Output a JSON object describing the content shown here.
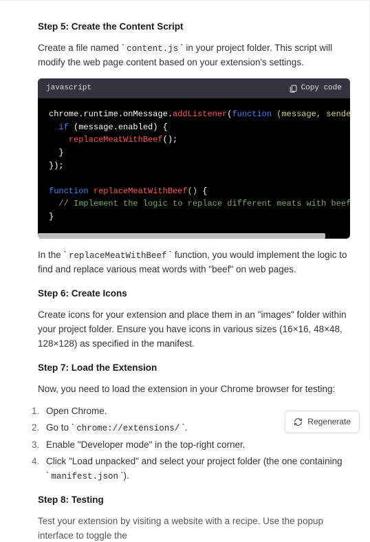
{
  "step5": {
    "title": "Step 5: Create the Content Script",
    "intro_pre": "Create a file named ",
    "intro_code": "content.js",
    "intro_post": " in your project folder. This script will modify the web page content based on your extension's settings."
  },
  "code_block": {
    "language": "javascript",
    "copy_label": "Copy code",
    "lines": [
      {
        "t": "plain",
        "segs": [
          {
            "c": "white",
            "t": "chrome.runtime.onMessage."
          },
          {
            "c": "red",
            "t": "addListener"
          },
          {
            "c": "white",
            "t": "("
          },
          {
            "c": "blue",
            "t": "function"
          },
          {
            "c": "white",
            "t": " "
          },
          {
            "c": "yellow",
            "t": "(message, sender, sendResponse"
          }
        ]
      },
      {
        "t": "plain",
        "segs": [
          {
            "c": "white",
            "t": "  "
          },
          {
            "c": "blue",
            "t": "if"
          },
          {
            "c": "white",
            "t": " (message.enabled) {"
          }
        ]
      },
      {
        "t": "plain",
        "segs": [
          {
            "c": "white",
            "t": "    "
          },
          {
            "c": "red",
            "t": "replaceMeatWithBeef"
          },
          {
            "c": "white",
            "t": "();"
          }
        ]
      },
      {
        "t": "plain",
        "segs": [
          {
            "c": "white",
            "t": "  }"
          }
        ]
      },
      {
        "t": "plain",
        "segs": [
          {
            "c": "white",
            "t": "});"
          }
        ]
      },
      {
        "t": "plain",
        "segs": [
          {
            "c": "white",
            "t": ""
          }
        ]
      },
      {
        "t": "plain",
        "segs": [
          {
            "c": "blue",
            "t": "function"
          },
          {
            "c": "white",
            "t": " "
          },
          {
            "c": "red",
            "t": "replaceMeatWithBeef"
          },
          {
            "c": "yellow",
            "t": "()"
          },
          {
            "c": "white",
            "t": " {"
          }
        ]
      },
      {
        "t": "plain",
        "segs": [
          {
            "c": "white",
            "t": "  "
          },
          {
            "c": "green",
            "t": "// Implement the logic to replace different meats with beef here"
          }
        ]
      },
      {
        "t": "plain",
        "segs": [
          {
            "c": "white",
            "t": "}"
          }
        ]
      }
    ]
  },
  "step5_outro": {
    "pre": "In the ",
    "code": "replaceMeatWithBeef",
    "post": " function, you would implement the logic to find and replace various meat words with \"beef\" on web pages."
  },
  "step6": {
    "title": "Step 6: Create Icons",
    "body": "Create icons for your extension and place them in an \"images\" folder within your project folder. Ensure you have icons in various sizes (16×16, 48×48, 128×128) as specified in the manifest."
  },
  "step7": {
    "title": "Step 7: Load the Extension",
    "intro": "Now, you need to load the extension in your Chrome browser for testing:",
    "items": [
      {
        "pre": "Open Chrome."
      },
      {
        "pre": "Go to ",
        "code": "chrome://extensions/",
        "post": "."
      },
      {
        "pre": "Enable \"Developer mode\" in the top-right corner."
      },
      {
        "pre": "Click \"Load unpacked\" and select your project folder (the one containing ",
        "code": "manifest.json",
        "post": ")."
      }
    ]
  },
  "step8": {
    "title": "Step 8: Testing",
    "body": "Test your extension by visiting a website with a recipe. Use the popup interface to toggle the"
  },
  "regenerate_label": "Regenerate"
}
